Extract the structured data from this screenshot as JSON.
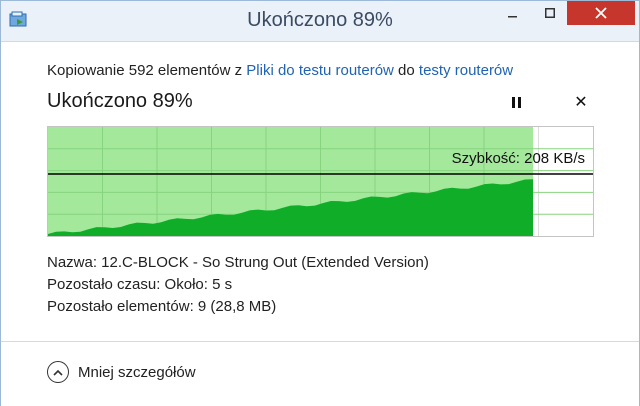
{
  "window": {
    "title": "Ukończono 89%"
  },
  "copy": {
    "prefix": "Kopiowanie 592 elementów z ",
    "source": "Pliki do testu routerów",
    "middle": " do ",
    "destination": "testy routerów"
  },
  "progress": {
    "heading": "Ukończono 89%",
    "percent": 89
  },
  "speed": {
    "label": "Szybkość: 208 KB/s"
  },
  "details": {
    "name": "Nazwa:  12.C-BLOCK - So Strung Out (Extended Version)",
    "time_left": "Pozostało czasu:  Około: 5 s",
    "items_left": "Pozostało elementów:  9 (28,8 MB)"
  },
  "footer": {
    "toggle_label": "Mniej szczegółów"
  },
  "colors": {
    "progress_fill": "#a4e89c",
    "speed_fill": "#10ae28",
    "title_bar": "#eaf1f8",
    "close_button": "#c7362c",
    "link": "#1f63b5"
  }
}
